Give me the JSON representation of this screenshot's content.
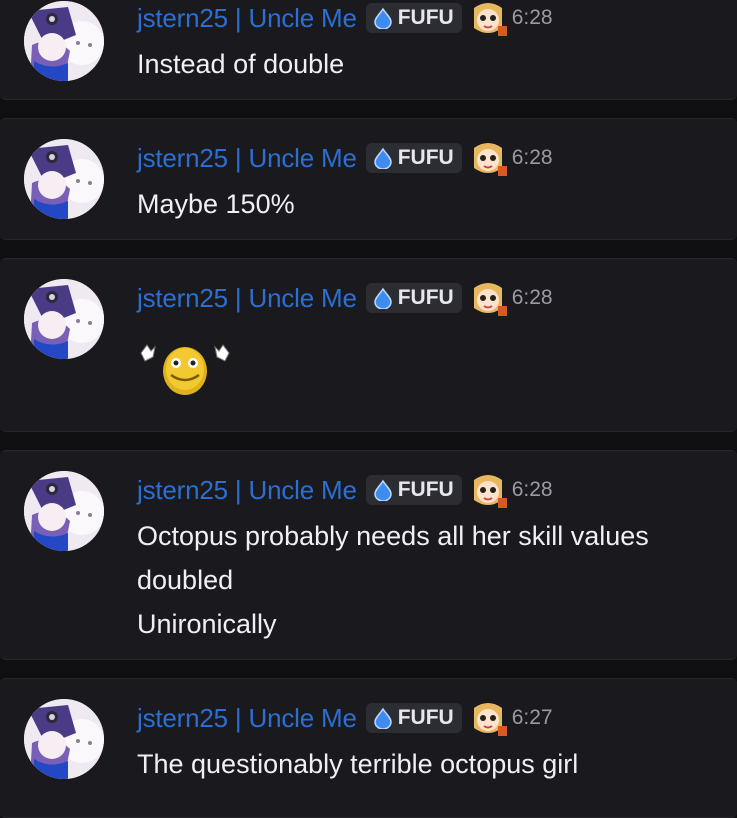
{
  "messages": [
    {
      "username": "jstern25 | Uncle Me",
      "tag": "FUFU",
      "time": "6:28",
      "lines": [
        "Instead of double"
      ]
    },
    {
      "username": "jstern25 | Uncle Me",
      "tag": "FUFU",
      "time": "6:28",
      "lines": [
        "Maybe 150%"
      ]
    },
    {
      "username": "jstern25 | Uncle Me",
      "tag": "FUFU",
      "time": "6:28",
      "emoji": "waving-smiley-emoji"
    },
    {
      "username": "jstern25 | Uncle Me",
      "tag": "FUFU",
      "time": "6:28",
      "lines": [
        "Octopus probably needs all her skill values",
        "doubled",
        "Unironically"
      ]
    },
    {
      "username": "jstern25 | Uncle Me",
      "tag": "FUFU",
      "time": "6:27",
      "lines": [
        "The questionably terrible octopus girl"
      ]
    }
  ],
  "icons": {
    "tag_icon": "water-drop-icon",
    "badge": "anime-girl-emoji-icon",
    "avatar": "user-avatar"
  },
  "colors": {
    "background": "#1a1a1e",
    "username": "#2a6fd1",
    "timestamp": "#9a9aa4",
    "text": "#eef0f3",
    "tag_bg": "#2c2c33"
  }
}
